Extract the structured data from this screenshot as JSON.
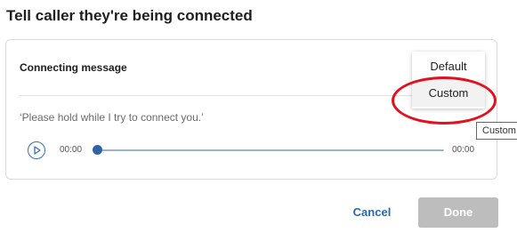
{
  "dialog": {
    "title": "Tell caller they're being connected"
  },
  "card": {
    "section_label": "Connecting message",
    "message": "‘Please hold while I try to connect you.’",
    "player": {
      "current_time": "00:00",
      "duration": "00:00",
      "progress": 0
    }
  },
  "dropdown": {
    "options": [
      "Default",
      "Custom"
    ],
    "highlighted": "Custom"
  },
  "tooltip": {
    "text": "Custom"
  },
  "footer": {
    "cancel_label": "Cancel",
    "done_label": "Done"
  },
  "colors": {
    "accent": "#2f64a3",
    "link": "#2a67b0",
    "disabled_button": "#bdbdbd",
    "annotation_circle": "#e3101f"
  },
  "icons": {
    "play": "play-icon"
  }
}
